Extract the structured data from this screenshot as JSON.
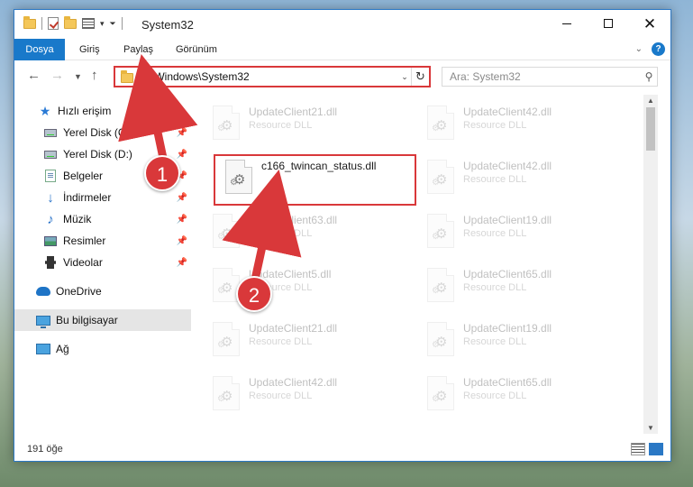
{
  "window": {
    "title": "System32"
  },
  "ribbon": {
    "tabs": [
      "Dosya",
      "Giriş",
      "Paylaş",
      "Görünüm"
    ],
    "help_label": "?"
  },
  "navigation": {
    "address": "C:\\Windows\\System32",
    "search_placeholder": "Ara: System32"
  },
  "sidebar": {
    "items": [
      {
        "label": "Hızlı erişim",
        "icon": "star-icon"
      },
      {
        "label": "Yerel Disk (C:)",
        "icon": "drive-icon",
        "pinned": true
      },
      {
        "label": "Yerel Disk (D:)",
        "icon": "drive-icon",
        "pinned": true
      },
      {
        "label": "Belgeler",
        "icon": "documents-icon",
        "pinned": true
      },
      {
        "label": "İndirmeler",
        "icon": "download-icon",
        "pinned": true
      },
      {
        "label": "Müzik",
        "icon": "music-icon",
        "pinned": true
      },
      {
        "label": "Resimler",
        "icon": "pictures-icon",
        "pinned": true
      },
      {
        "label": "Videolar",
        "icon": "videos-icon",
        "pinned": true
      },
      {
        "label": "OneDrive",
        "icon": "onedrive-icon"
      },
      {
        "label": "Bu bilgisayar",
        "icon": "computer-icon",
        "selected": true
      },
      {
        "label": "Ağ",
        "icon": "network-icon"
      }
    ]
  },
  "files": [
    {
      "name": "UpdateClient21.dll",
      "type": "Resource DLL",
      "faded": true
    },
    {
      "name": "UpdateClient42.dll",
      "type": "Resource DLL",
      "faded": true
    },
    {
      "name": "c166_twincan_status.dll",
      "type": "",
      "faded": false,
      "highlighted": true
    },
    {
      "name": "UpdateClient42.dll",
      "type": "Resource DLL",
      "faded": true
    },
    {
      "name": "UpdateClient63.dll",
      "type": "Resource DLL",
      "faded": true
    },
    {
      "name": "UpdateClient19.dll",
      "type": "Resource DLL",
      "faded": true
    },
    {
      "name": "UpdateClient5.dll",
      "type": "Resource DLL",
      "faded": true
    },
    {
      "name": "UpdateClient65.dll",
      "type": "Resource DLL",
      "faded": true
    },
    {
      "name": "UpdateClient21.dll",
      "type": "Resource DLL",
      "faded": true
    },
    {
      "name": "UpdateClient19.dll",
      "type": "Resource DLL",
      "faded": true
    },
    {
      "name": "UpdateClient42.dll",
      "type": "Resource DLL",
      "faded": true
    },
    {
      "name": "UpdateClient65.dll",
      "type": "Resource DLL",
      "faded": true
    }
  ],
  "status": {
    "item_count": "191 öğe"
  },
  "annotations": {
    "callout_1": "1",
    "callout_2": "2",
    "color": "#d9383a"
  }
}
